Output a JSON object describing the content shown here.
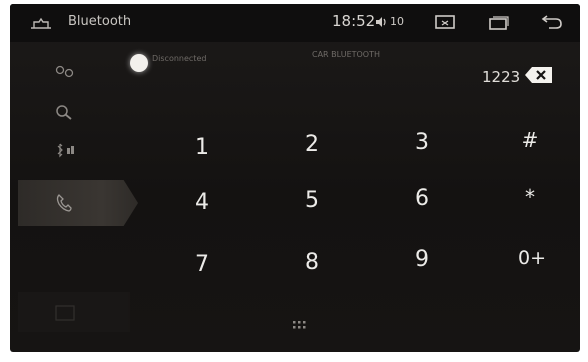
{
  "statusbar": {
    "title": "Bluetooth",
    "time": "18:52",
    "volume": "10",
    "icons": [
      "home-icon",
      "volume-icon",
      "screenshot-icon",
      "recent-apps-icon",
      "back-icon"
    ]
  },
  "sidebar": {
    "items": [
      {
        "name": "pairing",
        "icon": "link-icon"
      },
      {
        "name": "search",
        "icon": "search-icon"
      },
      {
        "name": "music",
        "icon": "bluetooth-music-icon"
      },
      {
        "name": "dial",
        "icon": "phone-icon",
        "active": true
      },
      {
        "name": "contacts",
        "icon": "contacts-icon"
      }
    ]
  },
  "connection": {
    "status": "Disconnected",
    "device": "CAR BLUETOOTH"
  },
  "dialer": {
    "number": "1223",
    "keys": [
      "1",
      "2",
      "3",
      "#",
      "4",
      "5",
      "6",
      "*",
      "7",
      "8",
      "9",
      "0+"
    ]
  },
  "colors": {
    "screen_bg": "#151312",
    "text": "#ecebe8",
    "active_tab": "#3a3632"
  }
}
